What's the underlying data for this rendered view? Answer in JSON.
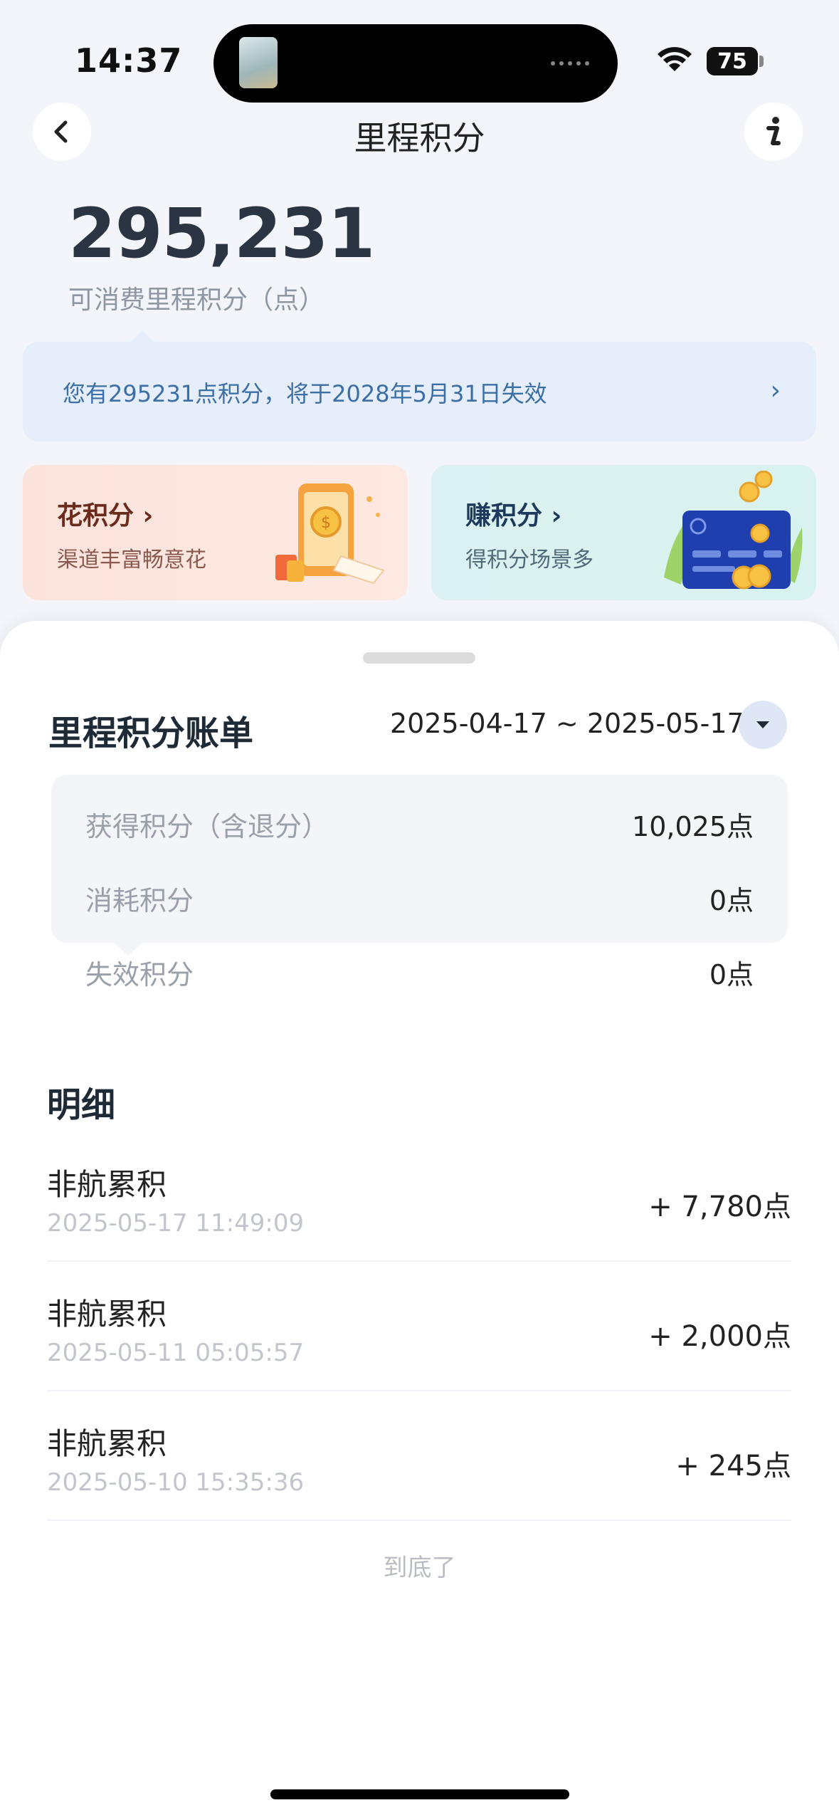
{
  "status_bar": {
    "time": "14:37",
    "battery": "75",
    "wifi_icon": "wifi-icon"
  },
  "nav": {
    "title": "里程积分",
    "back_icon": "chevron-left-icon",
    "info_icon": "info-icon"
  },
  "balance": {
    "points": "295,231",
    "label": "可消费里程积分（点）"
  },
  "notice": {
    "text": "您有295231点积分，将于2028年5月31日失效",
    "chevron": "›"
  },
  "cards": {
    "spend": {
      "title": "花积分 ›",
      "subtitle": "渠道丰富畅意花"
    },
    "earn": {
      "title": "赚积分 ›",
      "subtitle": "得积分场景多"
    }
  },
  "bill": {
    "title": "里程积分账单",
    "date_range": "2025-04-17 ~ 2025-05-17",
    "summary": [
      {
        "label": "获得积分（含退分）",
        "value": "10,025点"
      },
      {
        "label": "消耗积分",
        "value": "0点"
      },
      {
        "label": "失效积分",
        "value": "0点"
      }
    ]
  },
  "details": {
    "title": "明细",
    "items": [
      {
        "name": "非航累积",
        "time": "2025-05-17 11:49:09",
        "amount": "+ 7,780点"
      },
      {
        "name": "非航累积",
        "time": "2025-05-11 05:05:57",
        "amount": "+ 2,000点"
      },
      {
        "name": "非航累积",
        "time": "2025-05-10 15:35:36",
        "amount": "+ 245点"
      }
    ],
    "end_note": "到底了"
  },
  "colors": {
    "accent": "#3b6fa6",
    "background": "#f3f5fa",
    "sheet": "#ffffff"
  }
}
